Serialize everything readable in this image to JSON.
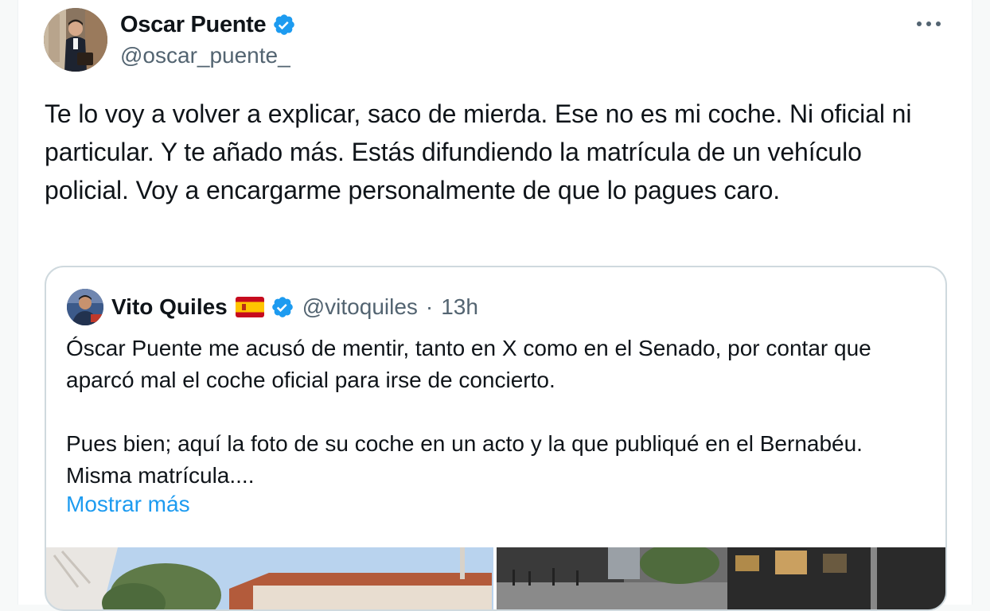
{
  "tweet": {
    "author": {
      "display_name": "Oscar Puente",
      "handle": "@oscar_puente_",
      "verified": true
    },
    "text": "Te lo voy a volver a explicar, saco de mierda. Ese no es mi coche. Ni oficial ni particular. Y te añado más. Estás difundiendo la matrícula de un vehículo policial. Voy a encargarme personalmente de que lo pagues caro.",
    "more_icon": "more-options-icon"
  },
  "quoted_tweet": {
    "author": {
      "display_name": "Vito Quiles",
      "flag": "spain-flag-icon",
      "handle": "@vitoquiles",
      "separator": "·",
      "time": "13h",
      "verified": true
    },
    "text_paragraph_1": "Óscar Puente me acusó de mentir, tanto en X como en el Senado, por contar que aparcó mal el coche oficial para irse de concierto.",
    "text_paragraph_2": "Pues bien; aquí la foto de su coche en un acto y la que publiqué en el Bernabéu. Misma matrícula....",
    "show_more_label": "Mostrar más",
    "media_count": 2
  },
  "colors": {
    "text_primary": "#0f1419",
    "text_secondary": "#536471",
    "link": "#1d9bf0",
    "verified": "#1d9bf0",
    "border": "#cfd9de"
  }
}
